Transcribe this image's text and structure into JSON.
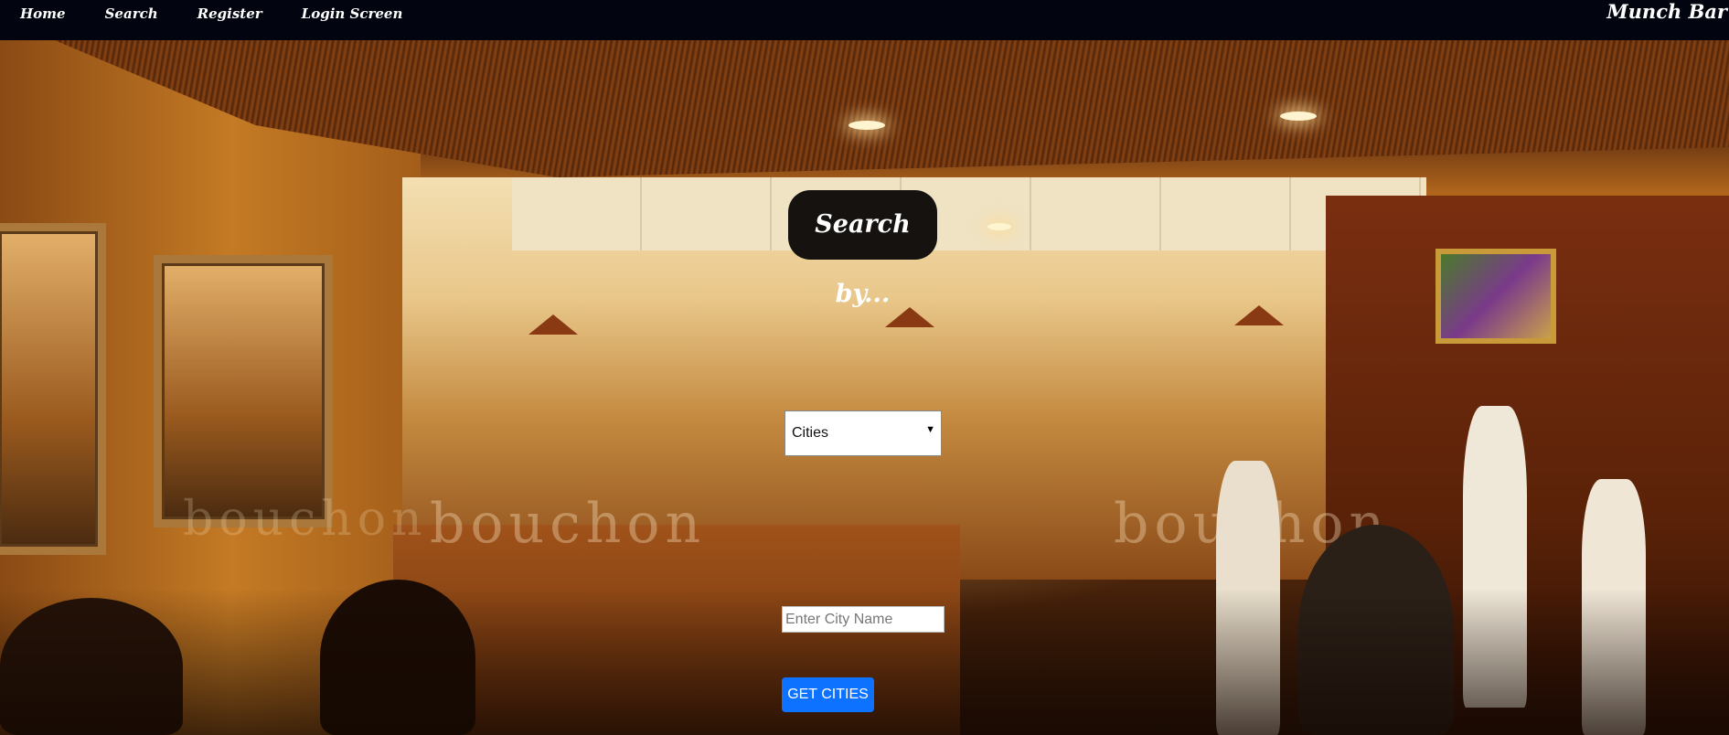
{
  "nav": {
    "links": [
      {
        "label": "Home"
      },
      {
        "label": "Search"
      },
      {
        "label": "Register"
      },
      {
        "label": "Login Screen"
      }
    ],
    "brand": "Munch Bar"
  },
  "hero": {
    "background": "restaurant-interior-photo",
    "watermark_text": "bouchon"
  },
  "search": {
    "heading": "Search by...",
    "city_select": {
      "selected": "Cities",
      "arrow_icon": "dropdown-triangle-icon"
    },
    "city_input": {
      "value": "",
      "placeholder": "Enter City Name"
    },
    "submit_label": "GET CITIES"
  },
  "colors": {
    "nav_background": "#020510",
    "heading_background": "#15120f",
    "button_primary": "#0d72ff",
    "text_on_dark": "#ffffff"
  }
}
